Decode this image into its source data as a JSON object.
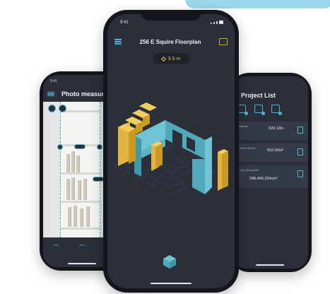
{
  "center_phone": {
    "status_time": "9:41",
    "title": "256 E Squire Floorplan",
    "distance_value": "3.5 m",
    "icons": {
      "menu": "hamburger-menu-icon",
      "layers": "layers-icon",
      "edit": "pencil-icon",
      "cube": "cube-icon"
    }
  },
  "left_phone": {
    "status_time": "9:41",
    "title": "Photo measure"
  },
  "right_phone": {
    "title": "Project List",
    "items": [
      {
        "name": "Hallway",
        "detail": "",
        "value": "220.12in"
      },
      {
        "name": "Coffee bench",
        "detail": "",
        "value": "502.50m²"
      },
      {
        "name": "Living Bookshelf",
        "detail": "",
        "value": "246,446.264cm²"
      }
    ]
  },
  "colors": {
    "accent": "#4fb6d3",
    "screen_bg": "#2b2f3a",
    "highlight": "#e9c25a"
  }
}
